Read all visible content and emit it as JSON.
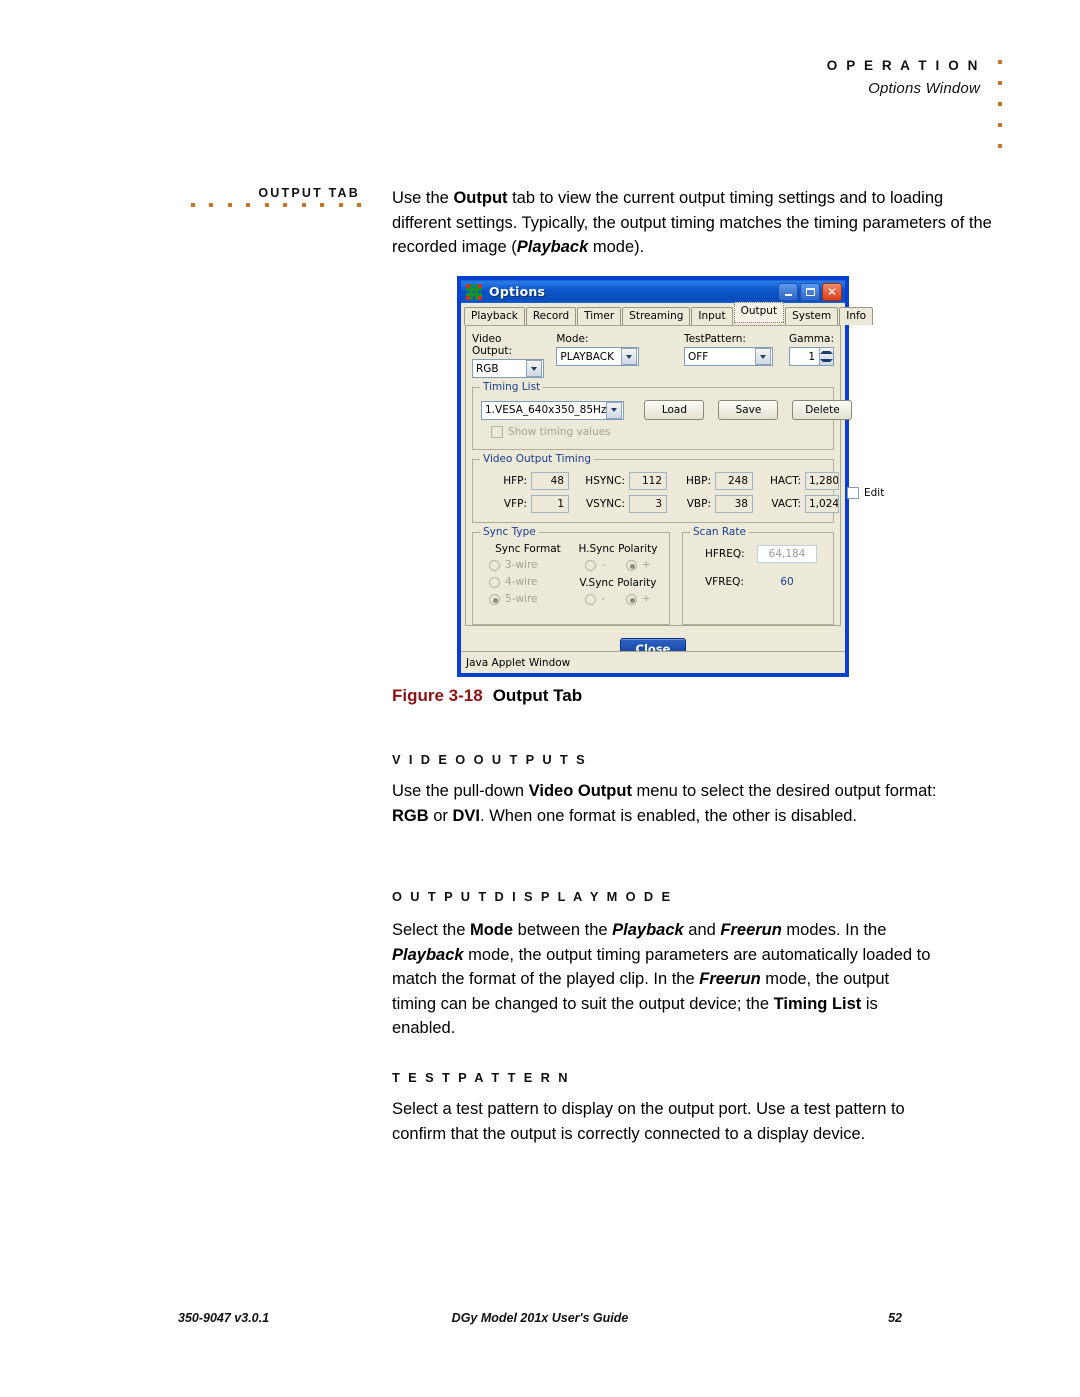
{
  "header": {
    "title": "O P E R A T I O N",
    "subtitle": "Options Window"
  },
  "side_label": "OUTPUT TAB",
  "intro": {
    "p1_a": "Use the ",
    "p1_b": "Output",
    "p1_c": " tab to view the current output timing settings and to loading different settings. Typically, the output timing matches the timing parameters of the recorded image (",
    "p1_d": "Playback",
    "p1_e": " mode)."
  },
  "figure": {
    "number": "Figure 3-18",
    "title": "Output Tab"
  },
  "dialog": {
    "title": "Options",
    "icon": "grid-icon",
    "window_buttons": {
      "minimize": "minimize-icon",
      "maximize": "maximize-icon",
      "close": "close-icon"
    },
    "tabs": [
      {
        "label": "Playback",
        "selected": false
      },
      {
        "label": "Record",
        "selected": false
      },
      {
        "label": "Timer",
        "selected": false
      },
      {
        "label": "Streaming",
        "selected": false
      },
      {
        "label": "Input",
        "selected": false
      },
      {
        "label": "Output",
        "selected": true
      },
      {
        "label": "System",
        "selected": false
      },
      {
        "label": "Info",
        "selected": false
      }
    ],
    "top_fields": {
      "video_output_label": "Video Output:",
      "video_output_value": "RGB",
      "mode_label": "Mode:",
      "mode_value": "PLAYBACK",
      "testpattern_label": "TestPattern:",
      "testpattern_value": "OFF",
      "gamma_label": "Gamma:",
      "gamma_value": "1"
    },
    "timing_list": {
      "legend": "Timing List",
      "selected": "1.VESA_640x350_85Hz",
      "load_button": "Load",
      "save_button": "Save",
      "delete_button": "Delete",
      "show_values_checkbox": "Show timing values"
    },
    "video_output_timing": {
      "legend": "Video Output Timing",
      "fields": [
        {
          "label": "HFP:",
          "value": "48"
        },
        {
          "label": "HSYNC:",
          "value": "112"
        },
        {
          "label": "HBP:",
          "value": "248"
        },
        {
          "label": "HACT:",
          "value": "1,280"
        },
        {
          "label": "VFP:",
          "value": "1"
        },
        {
          "label": "VSYNC:",
          "value": "3"
        },
        {
          "label": "VBP:",
          "value": "38"
        },
        {
          "label": "VACT:",
          "value": "1,024"
        }
      ],
      "edit_checkbox": "Edit"
    },
    "sync_type": {
      "legend": "Sync Type",
      "sync_format_label": "Sync Format",
      "sync_format_options": [
        {
          "label": "3-wire",
          "selected": false
        },
        {
          "label": "4-wire",
          "selected": false
        },
        {
          "label": "5-wire",
          "selected": true
        }
      ],
      "hsync_polarity_label": "H.Sync Polarity",
      "hsync_minus": "-",
      "hsync_plus": "+",
      "vsync_polarity_label": "V.Sync Polarity",
      "vsync_minus": "-",
      "vsync_plus": "+"
    },
    "scan_rate": {
      "legend": "Scan Rate",
      "hfreq_label": "HFREQ:",
      "hfreq_value": "64,184",
      "vfreq_label": "VFREQ:",
      "vfreq_value": "60"
    },
    "close_button": "Close",
    "status_text": "Java Applet Window"
  },
  "sections": [
    {
      "heading": "V I D E O   O U T P U T S",
      "p_a": "Use the pull-down ",
      "p_b": "Video Output",
      "p_c": " menu to select the desired output format: ",
      "p_d": "RGB",
      "p_e": " or ",
      "p_f": "DVI",
      "p_g": ". When one format is enabled, the other is disabled."
    },
    {
      "heading": "O U T P U T   D I S P L A Y   M O D E"
    },
    {
      "heading": "T E S T   P A T T E R N",
      "p": "Select a test pattern to display on the output port. Use a test pattern to confirm that the output is correctly connected to a display device."
    }
  ],
  "display_mode_para": {
    "a": "Select the ",
    "b": "Mode",
    "c": " between the ",
    "d": "Playback",
    "e": " and ",
    "f": "Freerun",
    "g": " modes. In the ",
    "h": "Playback",
    "i": " mode, the output timing parameters are automatically loaded to match the format of the played clip. In the ",
    "j": "Freerun",
    "k": " mode, the output timing can be changed to suit the output device; the ",
    "l": "Timing List",
    "m": " is enabled."
  },
  "footer": {
    "left": "350-9047 v3.0.1",
    "center": "DGy Model 201x User's Guide",
    "right": "52"
  },
  "colors": {
    "accent_orange": "#c8762a",
    "figure_red": "#8c1414",
    "title_blue": "#0a4cbb"
  }
}
